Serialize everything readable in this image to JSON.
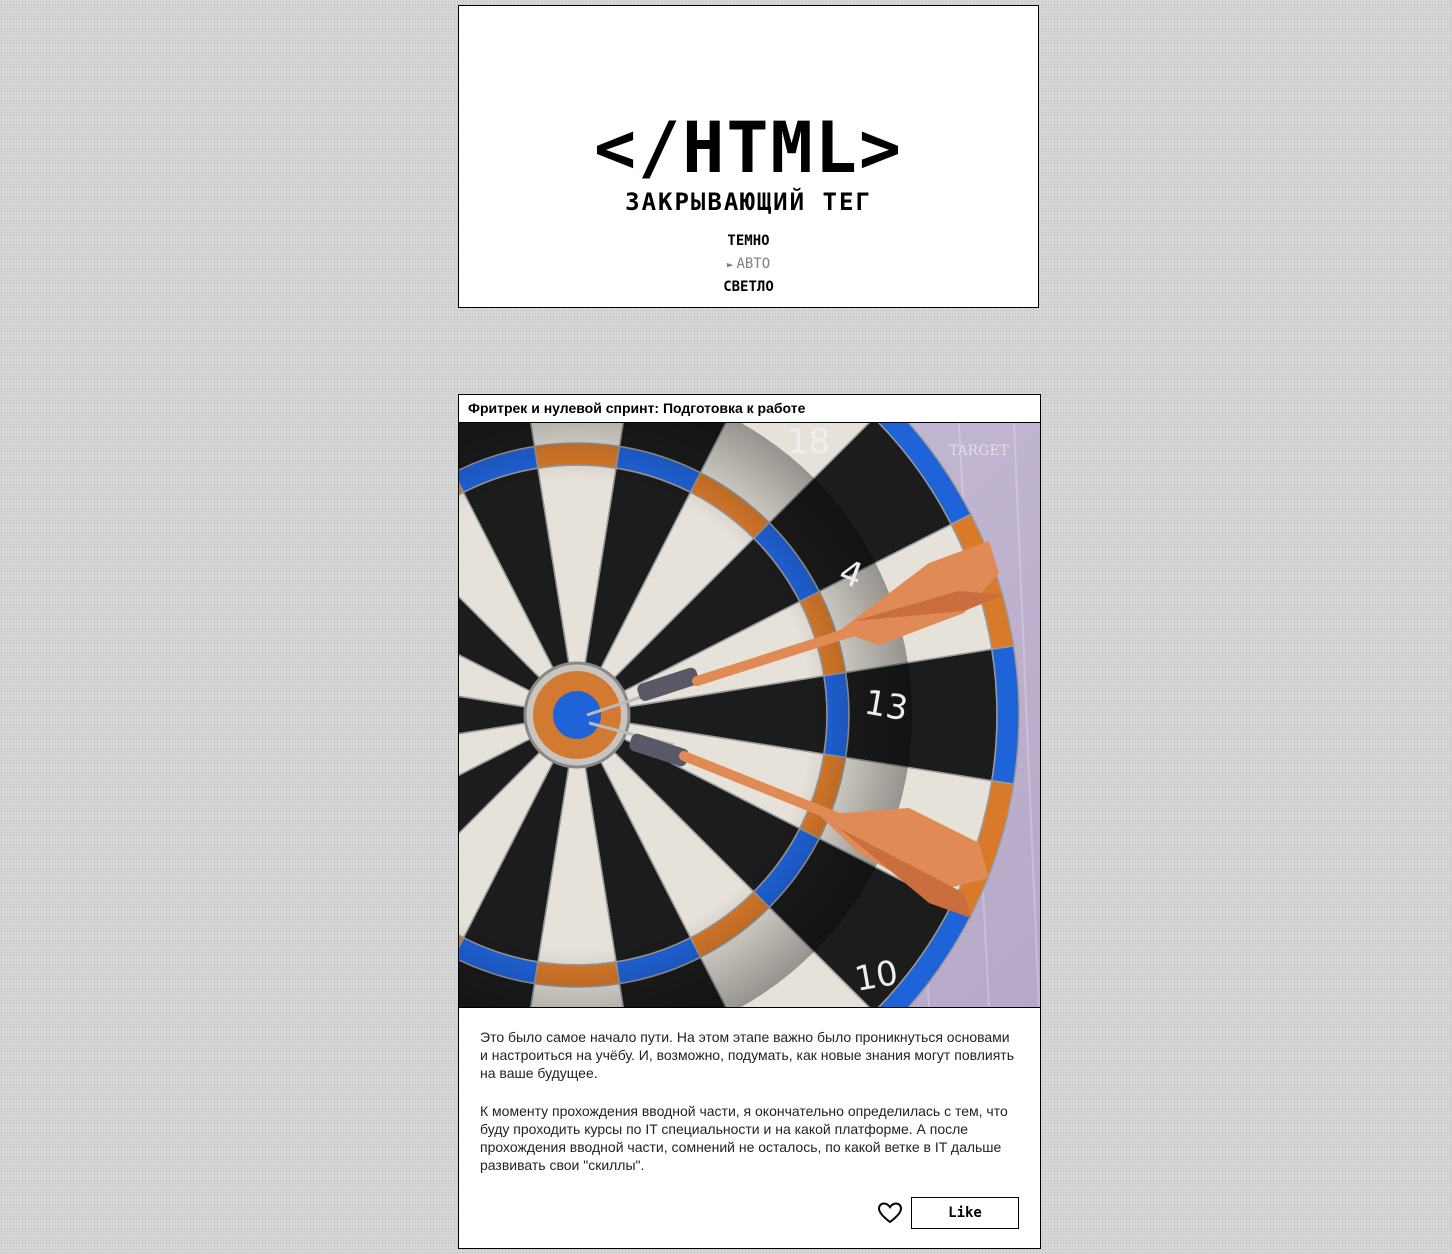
{
  "header": {
    "logo": "</HTML>",
    "subtitle": "ЗАКРЫВАЮЩИЙ ТЕГ",
    "theme_menu": [
      {
        "label": "ТЕМНО",
        "active": false
      },
      {
        "label": "АВТО",
        "active": true
      },
      {
        "label": "СВЕТЛО",
        "active": false
      }
    ],
    "active_marker": "►"
  },
  "post": {
    "title": "Фритрек и нулевой спринт: Подготовка к работе",
    "image": {
      "watermark": "TARGET",
      "board_numbers": [
        "18",
        "4",
        "13",
        "10"
      ]
    },
    "paragraphs": [
      "Это было самое начало пути. На этом этапе важно было проникнуться основами и настроиться на учёбу. И, возможно, подумать, как новые знания могут повлиять на ваше будущее.",
      "К моменту прохождения вводной части, я окончательно определилась с тем, что буду проходить курсы по IT специальности и на какой платформе. А после прохождения вводной части, сомнений не осталось, по какой ветке в IT дальше развивать свои \"скиллы\"."
    ],
    "like_label": "Like",
    "liked": false
  },
  "colors": {
    "background": "#d6d6d6",
    "card": "#ffffff",
    "border": "#000000",
    "inactive_text": "#808080",
    "dart_orange": "#e08a55",
    "board_blue": "#1f63d8",
    "board_orange": "#d97a2b"
  }
}
